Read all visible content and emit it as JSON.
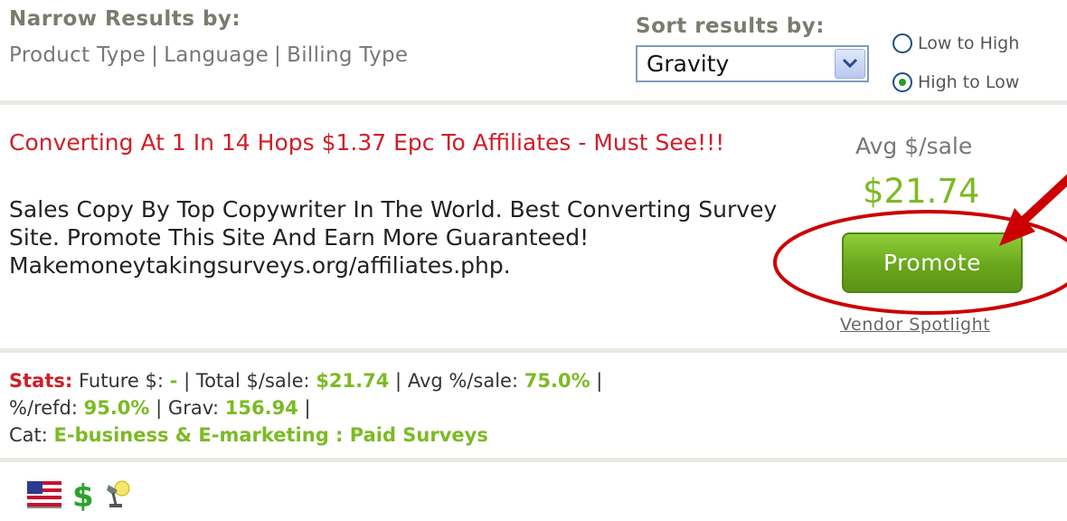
{
  "filters": {
    "narrow_title": "Narrow Results by:",
    "links": [
      "Product Type",
      "Language",
      "Billing Type"
    ],
    "separator": "|"
  },
  "sort": {
    "title": "Sort results by:",
    "selected": "Gravity",
    "options": [
      {
        "label": "Low to High",
        "checked": false
      },
      {
        "label": "High to Low",
        "checked": true
      }
    ]
  },
  "listing": {
    "title": "Converting At 1 In 14 Hops $1.37 Epc To Affiliates - Must See!!!",
    "description": "Sales Copy By Top Copywriter In The World. Best Converting Survey Site. Promote This Site And Earn More Guaranteed! Makemoneytakingsurveys.org/affiliates.php.",
    "avg_label": "Avg $/sale",
    "avg_value": "$21.74",
    "promote_label": "Promote",
    "vendor_link": "Vendor Spotlight"
  },
  "stats": {
    "label": "Stats:",
    "future_label": "Future $:",
    "future_value": "-",
    "total_label": "Total $/sale:",
    "total_value": "$21.74",
    "avg_pct_label": "Avg %/sale:",
    "avg_pct_value": "75.0%",
    "refd_label": "%/refd:",
    "refd_value": "95.0%",
    "grav_label": "Grav:",
    "grav_value": "156.94",
    "cat_label": "Cat:",
    "cat_value": "E-business & E-marketing : Paid Surveys",
    "sep": "|"
  },
  "icons": [
    "us-flag-icon",
    "dollar-icon",
    "spotlight-icon"
  ],
  "colors": {
    "accent_red": "#d01e29",
    "accent_green": "#7cba24",
    "annotation_red": "#cc0000"
  }
}
